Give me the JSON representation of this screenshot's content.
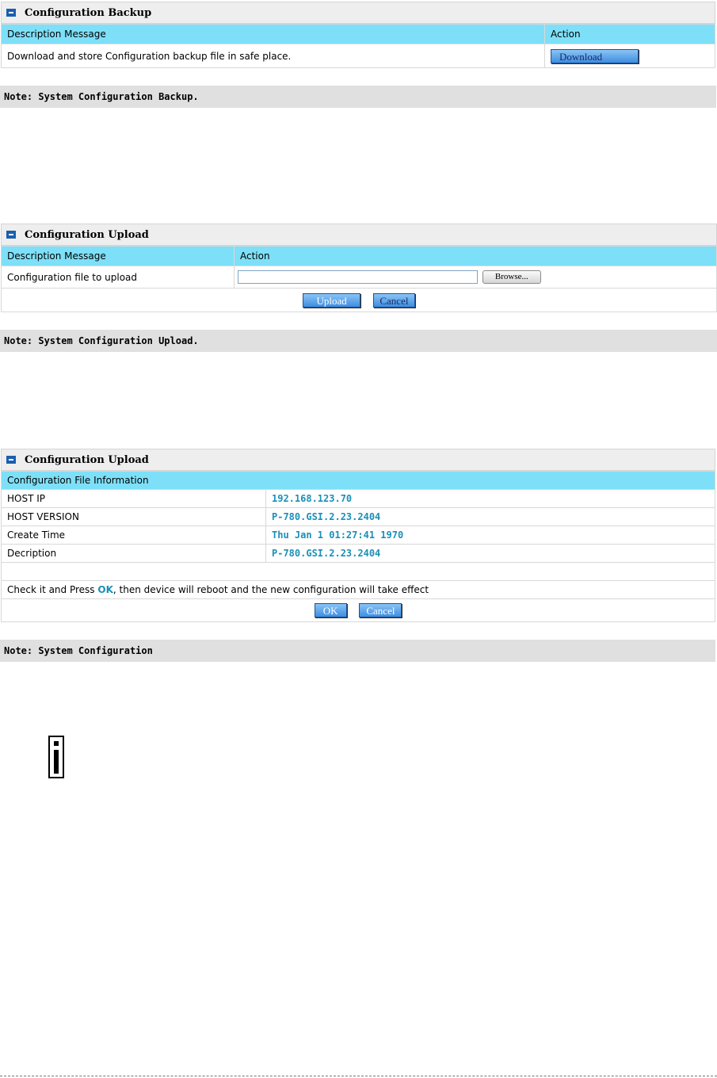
{
  "backup": {
    "title": "Configuration Backup",
    "col_desc": "Description Message",
    "col_action": "Action",
    "row_text": "Download and store Configuration backup file in safe place.",
    "download_label": "Download",
    "note": "Note: System Configuration Backup."
  },
  "upload": {
    "title": "Configuration Upload",
    "col_desc": "Description Message",
    "col_action": "Action",
    "row_label": "Configuration file to upload",
    "file_value": "",
    "browse_label": "Browse...",
    "upload_label": "Upload",
    "cancel_label": "Cancel",
    "note": "Note: System Configuration Upload."
  },
  "confirm": {
    "title": "Configuration Upload",
    "header": "Configuration File Information",
    "rows": [
      {
        "label": "HOST IP",
        "value": "192.168.123.70"
      },
      {
        "label": "HOST VERSION",
        "value": "P-780.GSI.2.23.2404"
      },
      {
        "label": "Create Time",
        "value": "Thu Jan 1 01:27:41 1970"
      },
      {
        "label": "Decription",
        "value": "P-780.GSI.2.23.2404"
      }
    ],
    "msg_pre": "Check it and Press ",
    "msg_ok": "OK",
    "msg_post": ", then device will reboot and the new configuration will take effect",
    "ok_label": "OK",
    "cancel_label": "Cancel",
    "note": "Note: System Configuration"
  },
  "colors": {
    "header_bg": "#7ee0f8",
    "value_text": "#1b8fb8",
    "button_blue": "#3f8de0",
    "note_bg": "#e0e0e0"
  },
  "icons": [
    "panel-icon",
    "info-icon"
  ]
}
